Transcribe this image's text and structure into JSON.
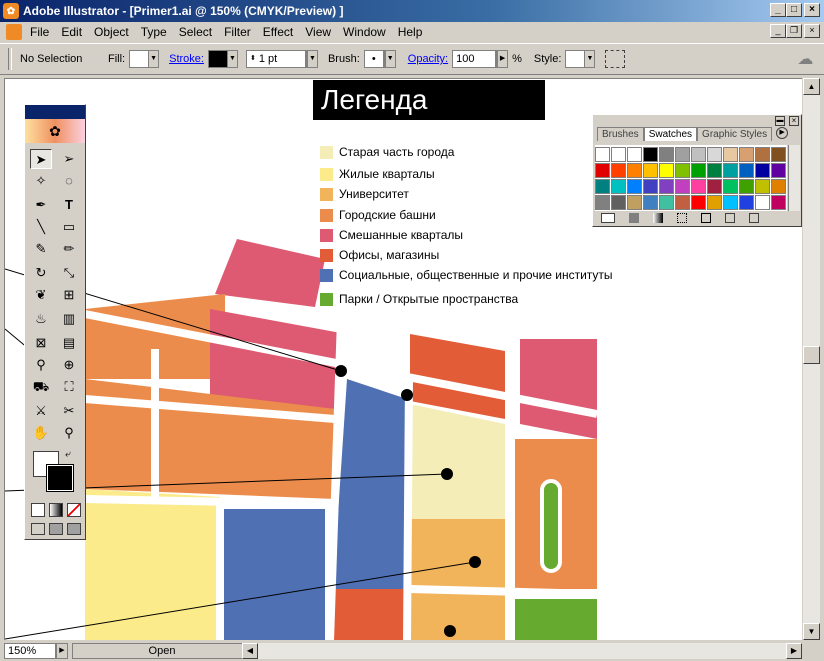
{
  "window": {
    "title": "Adobe Illustrator - [Primer1.ai @ 150% (CMYK/Preview) ]"
  },
  "menu": [
    "File",
    "Edit",
    "Object",
    "Type",
    "Select",
    "Filter",
    "Effect",
    "View",
    "Window",
    "Help"
  ],
  "control": {
    "selection": "No Selection",
    "fill_label": "Fill:",
    "stroke_label": "Stroke:",
    "weight_value": "1 pt",
    "brush_label": "Brush:",
    "brush_value": "•",
    "opacity_label": "Opacity:",
    "opacity_value": "100",
    "percent": "%",
    "style_label": "Style:"
  },
  "legend": {
    "title": "Легенда",
    "items": [
      {
        "label": "Старая часть города",
        "color": "#f5edb8"
      },
      {
        "label": "Жилые кварталы",
        "color": "#fbeb8a"
      },
      {
        "label": "Университет",
        "color": "#f2b45a"
      },
      {
        "label": "Городские башни",
        "color": "#ec8c4c"
      },
      {
        "label": "Смешанные кварталы",
        "color": "#de5a72"
      },
      {
        "label": "Офисы, магазины",
        "color": "#e25c38"
      },
      {
        "label": "Социальные, общественные и прочие институты",
        "color": "#5070b4"
      },
      {
        "label": "Парки / Открытые пространства",
        "color": "#66aa30"
      }
    ]
  },
  "swatches_panel": {
    "tabs": [
      "Brushes",
      "Swatches",
      "Graphic Styles"
    ],
    "active_tab": "Swatches"
  },
  "status": {
    "zoom": "150%",
    "info": "Open"
  }
}
